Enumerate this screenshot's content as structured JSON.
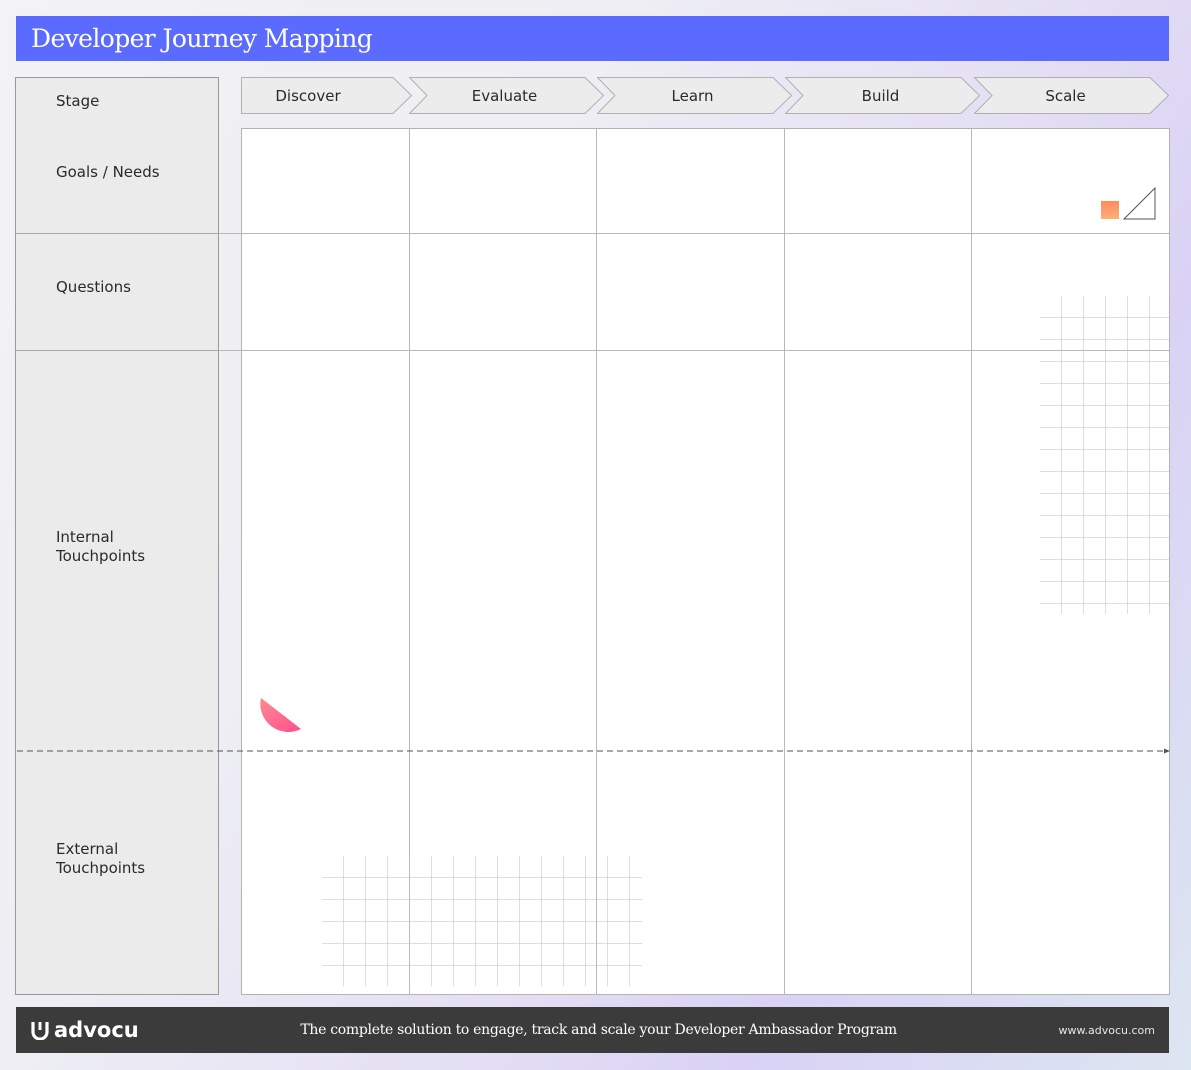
{
  "header": {
    "title": "Developer Journey Mapping"
  },
  "stages": [
    {
      "label": "Discover"
    },
    {
      "label": "Evaluate"
    },
    {
      "label": "Learn"
    },
    {
      "label": "Build"
    },
    {
      "label": "Scale"
    }
  ],
  "rows": {
    "stage": "Stage",
    "goals": "Goals / Needs",
    "questions": "Questions",
    "internal": "Internal\nTouchpoints",
    "external": "External\nTouchpoints"
  },
  "footer": {
    "brand": "advocu",
    "tagline": "The complete solution to engage, track and scale your Developer Ambassador Program",
    "url": "www.advocu.com"
  },
  "colors": {
    "header_bg": "#5b6aff",
    "stage_fill": "#ececec",
    "footer_bg": "#3b3b3b",
    "accent_pink": "#ff5c8a",
    "accent_orange": "#ff7b5c"
  }
}
